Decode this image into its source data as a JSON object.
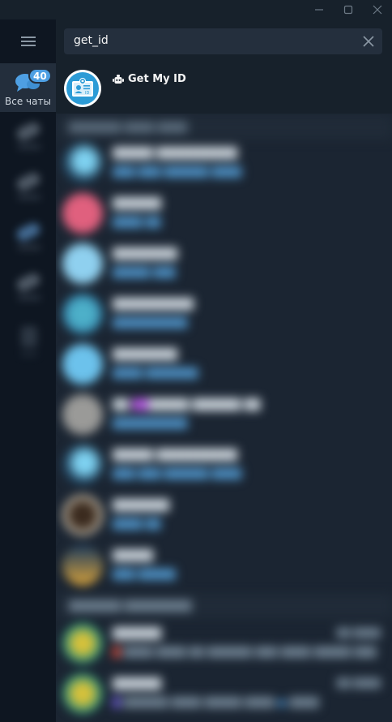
{
  "window": {
    "controls": [
      {
        "name": "minimize",
        "glyph": "—"
      },
      {
        "name": "maximize",
        "glyph": "□"
      },
      {
        "name": "close",
        "glyph": "✕"
      }
    ]
  },
  "sidebar": {
    "menu_icon": "hamburger-menu-icon",
    "folder_all": {
      "label": "Все чаты",
      "badge": "40",
      "icon": "chat-bubbles-icon"
    }
  },
  "search": {
    "value": "get_id",
    "clear_icon": "close-icon"
  },
  "results": [
    {
      "name": "Get My ID",
      "bot_icon": "bot-icon",
      "avatar_icon": "id-card-icon"
    }
  ],
  "colors": {
    "accent": "#4e9fe3",
    "sidebar_bg": "#0e1621",
    "panel_bg": "#17212b",
    "search_bg": "#242f3d",
    "selected_folder_bg": "#232e3c"
  }
}
